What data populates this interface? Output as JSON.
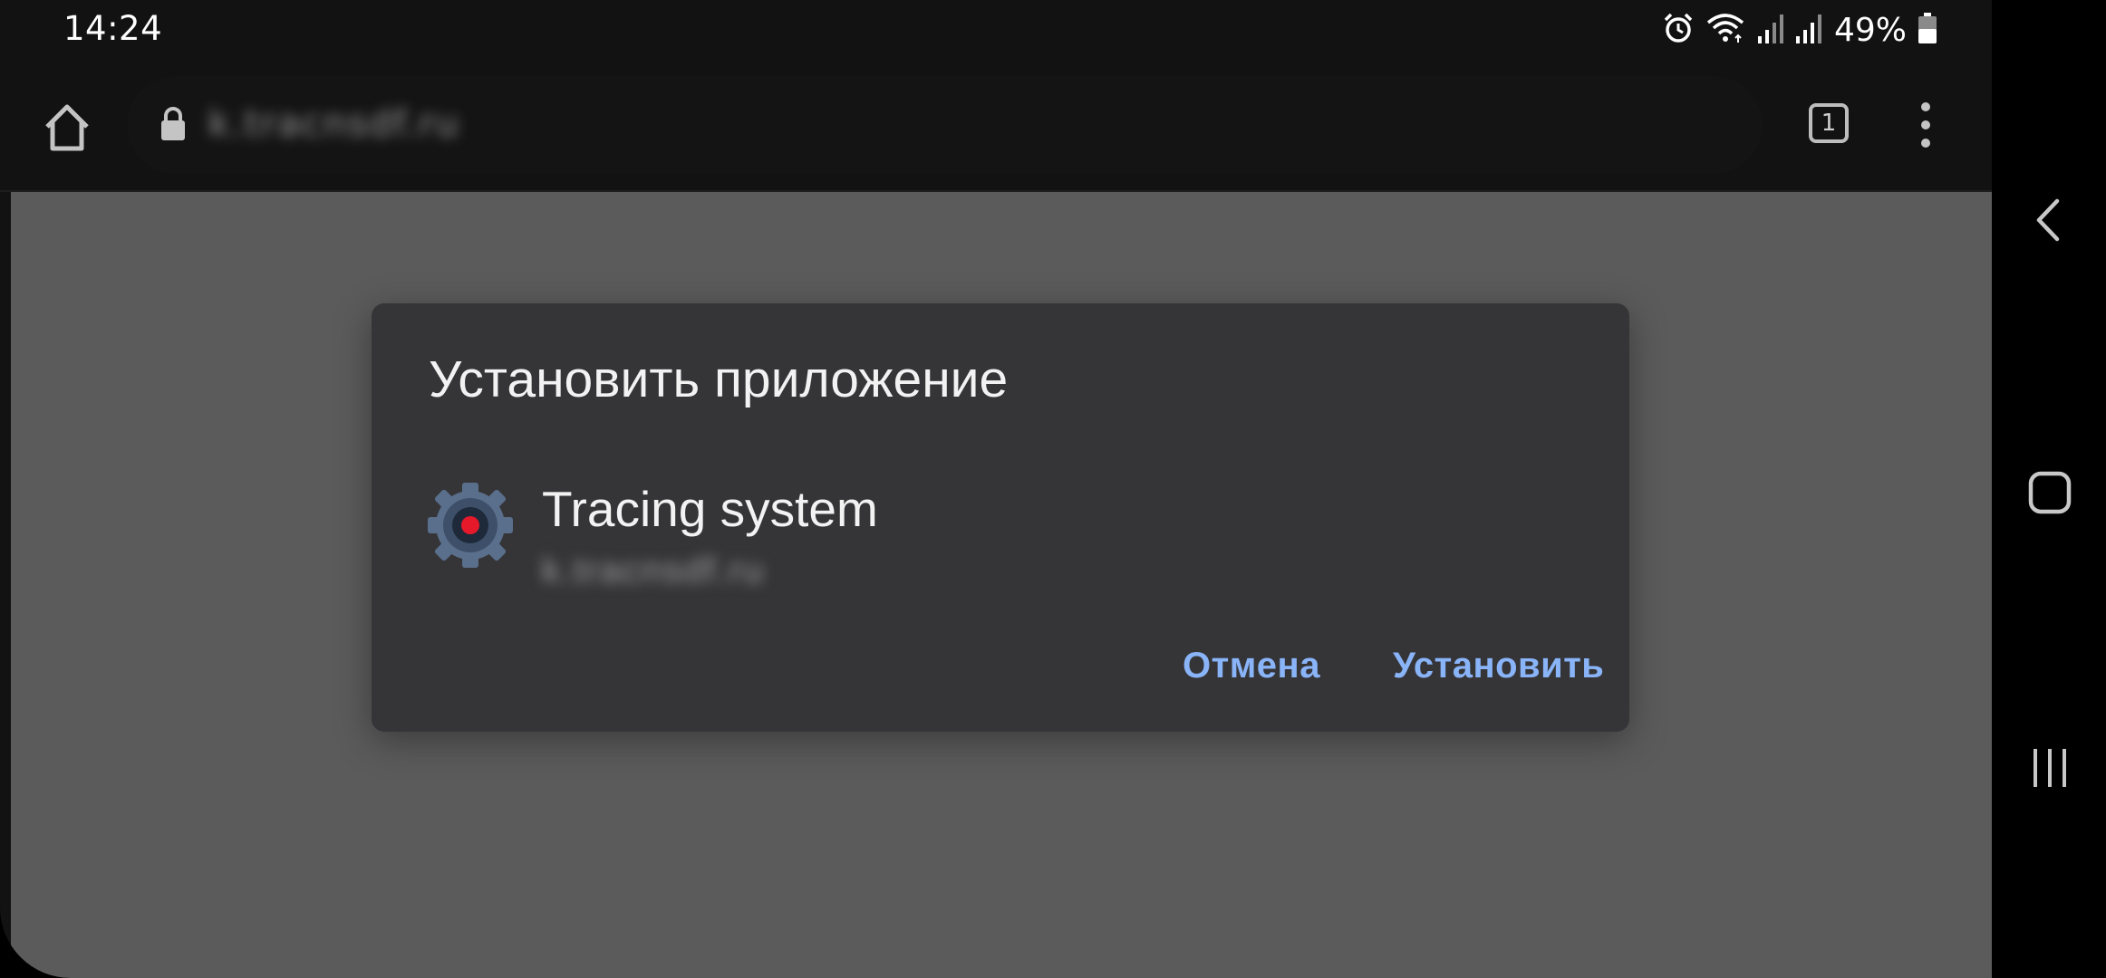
{
  "status_bar": {
    "time": "14:24",
    "battery_percent": "49%",
    "icons": [
      "alarm-icon",
      "wifi-icon",
      "signal-icon",
      "signal-icon",
      "battery-icon"
    ]
  },
  "toolbar": {
    "url": "k.tracnsdf.ru",
    "tab_count": "1"
  },
  "dialog": {
    "title": "Установить приложение",
    "app_name": "Tracing system",
    "app_origin": "k.tracnsdf.ru",
    "cancel_label": "Отмена",
    "install_label": "Установить"
  },
  "colors": {
    "accent": "#8ab4f8",
    "dialog_bg": "#353538",
    "scrim": "#5b5b5b",
    "icon_dot": "#e5192a"
  }
}
